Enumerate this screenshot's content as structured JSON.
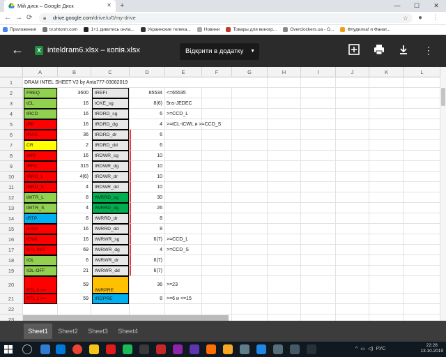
{
  "browser": {
    "tab_title": "Мій диск – Google Диск",
    "url_host": "drive.google.com",
    "url_path": "/drive/u/0/my-drive",
    "bookmarks": [
      {
        "label": "Приложения",
        "color": "#4285f4"
      },
      {
        "label": "tv.shtorm.com",
        "color": "#777777"
      },
      {
        "label": "1+1 дивитись онла...",
        "color": "#222222"
      },
      {
        "label": "Украинские телека...",
        "color": "#333333"
      },
      {
        "label": "Новини",
        "color": "#aaaaaa"
      },
      {
        "label": "Товары для виногр...",
        "color": "#c0392b"
      },
      {
        "label": "Overclockers.ua - O...",
        "color": "#888888"
      },
      {
        "label": "Флудилка! и Фанат...",
        "color": "#f39c12"
      }
    ]
  },
  "viewer": {
    "file_name": "inteldram6.xlsx – копія.xlsx",
    "open_with_label": "Відкрити в додатку",
    "file_icon_letter": "X"
  },
  "sheet": {
    "columns": [
      "A",
      "B",
      "C",
      "D",
      "E",
      "F",
      "G",
      "H",
      "I",
      "J",
      "K",
      "L"
    ],
    "row_numbers": [
      "1",
      "2",
      "3",
      "4",
      "5",
      "6",
      "7",
      "8",
      "9",
      "10",
      "11",
      "12",
      "13",
      "14",
      "15",
      "16",
      "17",
      "18",
      "19",
      "20",
      "21",
      "22",
      "23"
    ],
    "title": "DRAM INTEL SHEET V2 by Anta777-03082019",
    "rows": [
      {
        "a": "FREQ",
        "a_color": "#92d050",
        "b": "3600",
        "c": "tREFI",
        "c_color": "#e8e8e8",
        "d": "65534",
        "e": "<=65535"
      },
      {
        "a": "tCL",
        "a_color": "#92d050",
        "b": "16",
        "c": "tCKE_sg",
        "c_color": "#e8e8e8",
        "d": "8(6)",
        "e": "5ns-JEDEC"
      },
      {
        "a": "tRCD",
        "a_color": "#92d050",
        "b": "16",
        "c": "tRDRD_sg",
        "c_color": "#e8e8e8",
        "d": "6",
        "e": ">=CCD_L"
      },
      {
        "a": "tRP",
        "a_color": "#ff0000",
        "b": "16",
        "c": "tRDRD_dg",
        "c_color": "#e8e8e8",
        "d": "4",
        "e": ">=tCL-tCWL и >=CCD_S"
      },
      {
        "a": "tRAS",
        "a_color": "#ff0000",
        "b": "36",
        "c": "tRDRD_dr",
        "c_color": "#e8e8e8",
        "d": "6",
        "e": ""
      },
      {
        "a": "CR",
        "a_color": "#ffff00",
        "b": "2",
        "c": "tRDRD_dd",
        "c_color": "#e8e8e8",
        "d": "6",
        "e": ""
      },
      {
        "a": "tWR",
        "a_color": "#ff0000",
        "b": "16",
        "c": "tRDWR_sg",
        "c_color": "#e8e8e8",
        "d": "10",
        "e": ""
      },
      {
        "a": "tRFC",
        "a_color": "#ff0000",
        "b": "315",
        "c": "tRDWR_dg",
        "c_color": "#e8e8e8",
        "d": "10",
        "e": ""
      },
      {
        "a": "tRRD_L",
        "a_color": "#ff0000",
        "b": "4(6)",
        "c": "tRDWR_dr",
        "c_color": "#e8e8e8",
        "d": "10",
        "e": ""
      },
      {
        "a": "tRRD_S",
        "a_color": "#ff0000",
        "b": "4",
        "c": "tRDWR_dd",
        "c_color": "#e8e8e8",
        "d": "10",
        "e": ""
      },
      {
        "a": "tWTR_L",
        "a_color": "#92d050",
        "b": "8",
        "c": "tWRRD_sg",
        "c_color": "#00b050",
        "d": "30",
        "e": ""
      },
      {
        "a": "tWTR_S",
        "a_color": "#92d050",
        "b": "4",
        "c": "tWRRD_dg",
        "c_color": "#00b050",
        "d": "26",
        "e": ""
      },
      {
        "a": "tRTP",
        "a_color": "#00b0f0",
        "b": "8",
        "c": "tWRRD_dr",
        "c_color": "#e8e8e8",
        "d": "8",
        "e": ""
      },
      {
        "a": "tFAW",
        "a_color": "#ff0000",
        "b": "16",
        "c": "tWRRD_dd",
        "c_color": "#e8e8e8",
        "d": "8",
        "e": ""
      },
      {
        "a": "tCWL",
        "a_color": "#ff0000",
        "b": "16",
        "c": "tWRWR_sg",
        "c_color": "#e8e8e8",
        "d": "6(7)",
        "e": ">=CCD_L"
      },
      {
        "a": "RTL INIT",
        "a_color": "#ff0000",
        "b": "69",
        "c": "tWRWR_dg",
        "c_color": "#e8e8e8",
        "d": "4",
        "e": ">=CCD_S"
      },
      {
        "a": "IOL",
        "a_color": "#92d050",
        "b": "6",
        "c": "tWRWR_dr",
        "c_color": "#e8e8e8",
        "d": "6(7)",
        "e": ""
      },
      {
        "a": "IOL-OFF",
        "a_color": "#92d050",
        "b": "21",
        "c": "tWRWR_dd",
        "c_color": "#e8e8e8",
        "d": "6(7)",
        "e": ""
      },
      {
        "a": "RTL 0 >=",
        "a_color": "#ff0000",
        "b": "59",
        "c": "tWRPRE",
        "c_color": "#ffc000",
        "d": "36",
        "e": ">=23"
      },
      {
        "a": "RTL 1 >=",
        "a_color": "#ff0000",
        "b": "59",
        "c": "tRDPRE",
        "c_color": "#00b0f0",
        "d": "8",
        "e": ">=6 и <=15"
      }
    ],
    "tabs": [
      "Sheet1",
      "Sheet2",
      "Sheet3",
      "Sheet4"
    ],
    "active_tab": "Sheet1"
  },
  "taskbar": {
    "lang": "РУС",
    "time": "22:28",
    "date": "13.10.2019"
  }
}
